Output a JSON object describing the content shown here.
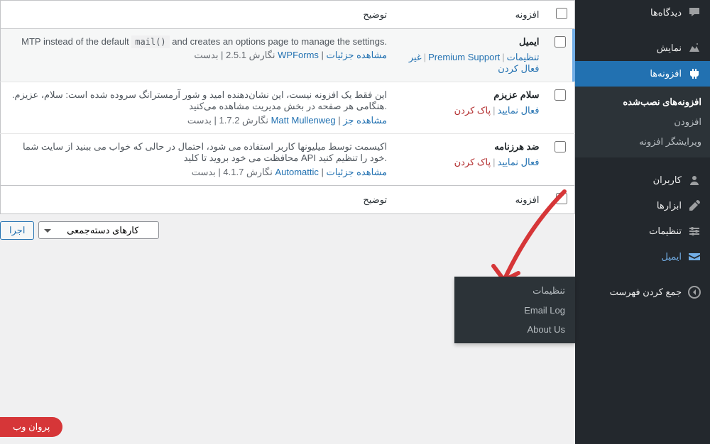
{
  "sidebar": {
    "items": [
      {
        "icon": "comments",
        "label": "دیدگاه‌ها"
      },
      {
        "icon": "appearance",
        "label": "نمایش"
      },
      {
        "icon": "plugins",
        "label": "افزونه‌ها",
        "active": true
      },
      {
        "icon": "users",
        "label": "کاربران"
      },
      {
        "icon": "tools",
        "label": "ابزارها"
      },
      {
        "icon": "settings",
        "label": "تنظیمات"
      },
      {
        "icon": "email",
        "label": "ایمیل"
      },
      {
        "icon": "collapse",
        "label": "جمع کردن فهرست"
      }
    ],
    "submenu": [
      {
        "label": "افزونه‌های نصب‌شده",
        "current": true
      },
      {
        "label": "افزودن"
      },
      {
        "label": "ویرایشگر افزونه"
      }
    ],
    "flyout": [
      {
        "label": "تنظیمات"
      },
      {
        "label": "Email Log"
      },
      {
        "label": "About Us"
      }
    ]
  },
  "table": {
    "head_plugin": "افزونه",
    "head_desc": "توضیح",
    "rows": [
      {
        "name": "ایمیل",
        "active": true,
        "actions": [
          {
            "t": "تنظیمات",
            "c": "blue"
          },
          {
            "t": "Premium Support",
            "c": "blue"
          },
          {
            "t": "غیر فعال کردن",
            "c": "blue"
          }
        ],
        "desc_pre": "MTP instead of the default ",
        "desc_code": "mail()",
        "desc_post": " and creates an options page to manage the settings.",
        "ver": "نگارش 2.5.1 | بدست ",
        "author": "WPForms",
        "details": "مشاهده جزئیات"
      },
      {
        "name": "سلام عزیزم",
        "actions": [
          {
            "t": "فعال نمایید",
            "c": "blue"
          },
          {
            "t": "پاک کردن",
            "c": "red"
          }
        ],
        "desc": "این فقط یک افزونه نیست، این نشان‌دهنده امید و شور آرمسترانگ سروده شده است: سلام، عزیزم. هنگامی هر صفحه در بخش مدیریت مشاهده می‌کنید.",
        "ver": "نگارش 1.7.2 | بدست ",
        "author": "Matt Mullenweg",
        "details": "مشاهده جز"
      },
      {
        "name": "ضد هرزنامه",
        "actions": [
          {
            "t": "فعال نمایید",
            "c": "blue"
          },
          {
            "t": "پاک کردن",
            "c": "red"
          }
        ],
        "desc": "اکیسمت توسط میلیونها کاربر استفاده می شود، احتمال در حالی که خواب می ببنید از سایت شما محافظت می خود بروید تا کلید API خود را تنظیم کنید.",
        "ver": "نگارش 4.1.7 | بدست ",
        "author": "Automattic",
        "details": "مشاهده جزئیات"
      }
    ]
  },
  "bulk": {
    "label": "کارهای دسته‌جمعی",
    "apply": "اجرا"
  },
  "badge": "پروان وب"
}
